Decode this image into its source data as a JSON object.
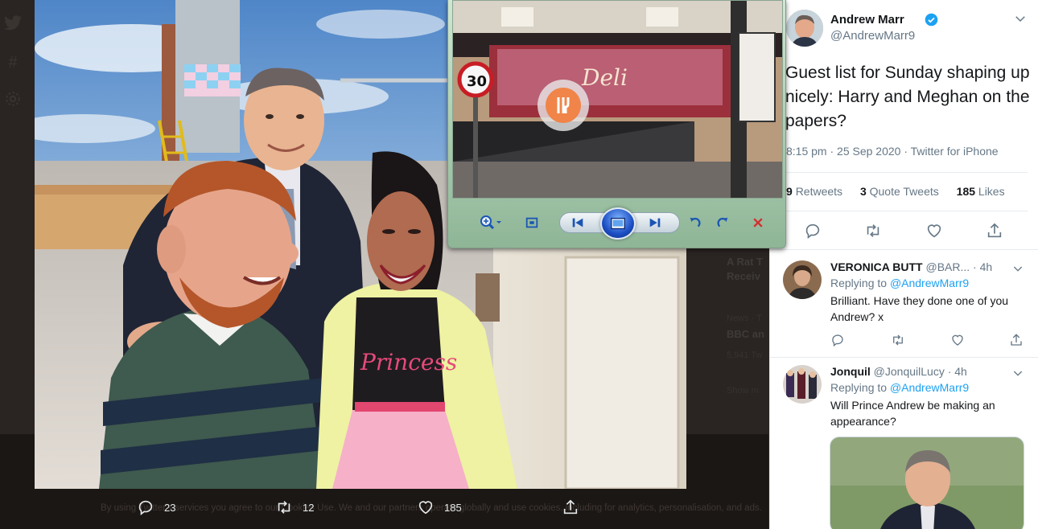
{
  "photo_actions": {
    "replies": "23",
    "retweets": "12",
    "likes": "185"
  },
  "background": {
    "cookie_text": "By using Twitter's services you agree to our Cookies Use. We and our partners operate globally and use cookies, including for analytics, personalisation, and ads.",
    "side_item1_title": "A Rat T",
    "side_item1_sub": "Receiv",
    "side_item2_meta": "News · T",
    "side_item2_title": "BBC an",
    "side_item2_count": "5,941 Tw",
    "show_more": "Show m"
  },
  "tweet": {
    "author_name": "Andrew Marr",
    "author_handle": "@AndrewMarr9",
    "text": "Guest list for Sunday shaping up nicely: Harry and Meghan on the papers?",
    "meta": "8:15 pm · 25 Sep 2020 · Twitter for iPhone",
    "retweets_count": "9",
    "retweets_label": "Retweets",
    "quote_count": "3",
    "quote_label": "Quote Tweets",
    "likes_count": "185",
    "likes_label": "Likes"
  },
  "replies": [
    {
      "name": "VERONICA BUTT",
      "handle": "@BAR...",
      "time": "· 4h",
      "replying_label": "Replying to",
      "replying_to": "@AndrewMarr9",
      "body": "Brilliant.  Have they done one of you Andrew? x"
    },
    {
      "name": "Jonquil",
      "handle": "@JonquilLucy",
      "time": "· 4h",
      "replying_label": "Replying to",
      "replying_to": "@AndrewMarr9",
      "body": "Will Prince Andrew be making an appearance?"
    }
  ],
  "viewer": {
    "speed_sign": "30",
    "shop_sign": "Deli"
  },
  "colors": {
    "twitter_blue": "#1da1f2",
    "verified_blue": "#1da1f2",
    "pane_bg": "#ffffff"
  },
  "icons": [
    "twitter-bird-icon",
    "hashtag-icon",
    "gear-icon",
    "reply-icon",
    "retweet-icon",
    "like-icon",
    "share-icon",
    "verified-badge-icon",
    "chevron-down-icon",
    "zoom-icon",
    "fit-to-window-icon",
    "previous-icon",
    "slideshow-icon",
    "next-icon",
    "rotate-left-icon",
    "rotate-right-icon",
    "delete-icon"
  ]
}
